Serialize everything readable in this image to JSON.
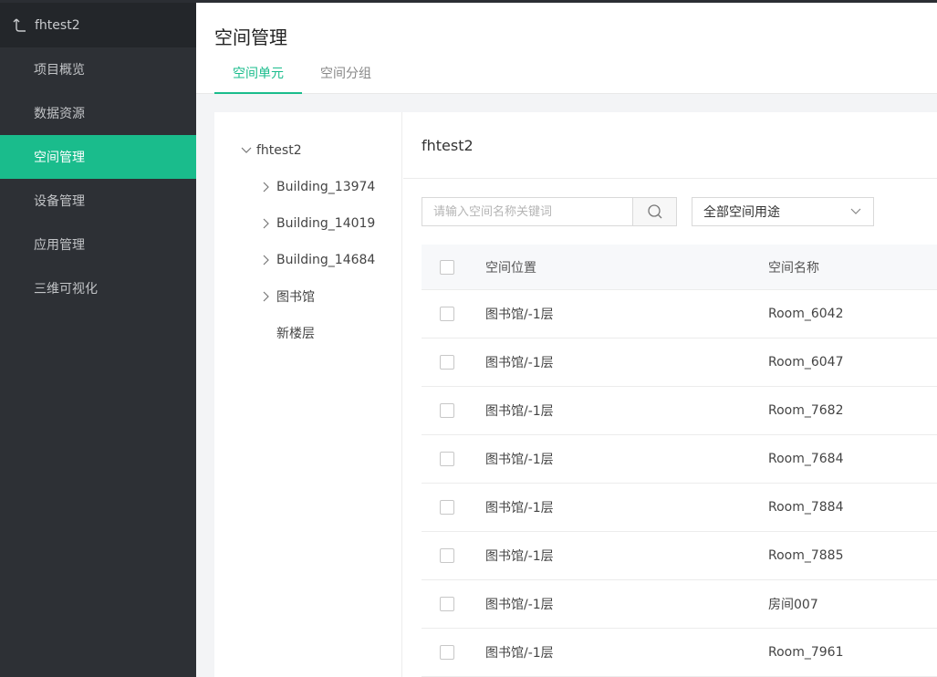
{
  "sidebar": {
    "project_name": "fhtest2",
    "items": [
      {
        "label": "项目概览",
        "active": false
      },
      {
        "label": "数据资源",
        "active": false
      },
      {
        "label": "空间管理",
        "active": true
      },
      {
        "label": "设备管理",
        "active": false
      },
      {
        "label": "应用管理",
        "active": false
      },
      {
        "label": "三维可视化",
        "active": false
      }
    ]
  },
  "header": {
    "title": "空间管理",
    "tabs": [
      {
        "label": "空间单元",
        "active": true
      },
      {
        "label": "空间分组",
        "active": false
      }
    ]
  },
  "tree": {
    "root": "fhtest2",
    "children": [
      "Building_13974",
      "Building_14019",
      "Building_14684",
      "图书馆",
      "新楼层"
    ]
  },
  "detail": {
    "title": "fhtest2",
    "search_placeholder": "请输入空间名称关键词",
    "select_value": "全部空间用途",
    "columns": [
      "空间位置",
      "空间名称"
    ],
    "rows": [
      {
        "location": "图书馆/-1层",
        "name": "Room_6042"
      },
      {
        "location": "图书馆/-1层",
        "name": "Room_6047"
      },
      {
        "location": "图书馆/-1层",
        "name": "Room_7682"
      },
      {
        "location": "图书馆/-1层",
        "name": "Room_7684"
      },
      {
        "location": "图书馆/-1层",
        "name": "Room_7884"
      },
      {
        "location": "图书馆/-1层",
        "name": "Room_7885"
      },
      {
        "location": "图书馆/-1层",
        "name": "房间007"
      },
      {
        "location": "图书馆/-1层",
        "name": "Room_7961"
      }
    ]
  },
  "colors": {
    "accent": "#1abc8c",
    "sidebar_bg": "#2d3035"
  }
}
